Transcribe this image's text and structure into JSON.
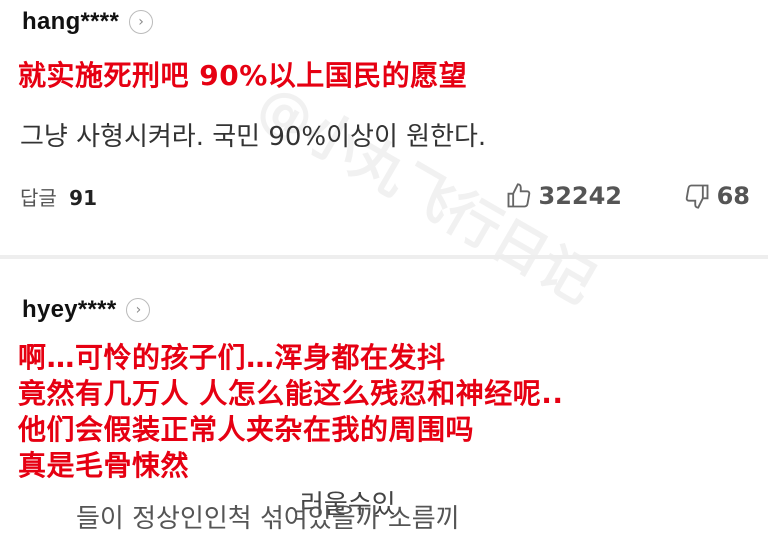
{
  "comments": [
    {
      "username": "hang****",
      "red_lines": [
        "就实施死刑吧 90%以上国民的愿望"
      ],
      "original_text": "그냥 사형시켜라. 국민 90%이상이 원한다.",
      "reply_label": "답글",
      "reply_count": "91",
      "likes": "32242",
      "dislikes": "68"
    },
    {
      "username": "hyey****",
      "red_lines": [
        "啊…可怜的孩子们…浑身都在发抖",
        "竟然有几万人 人怎么能这么残忍和神经呢..",
        "他们会假装正常人夹杂在我的周围吗",
        "真是毛骨悚然"
      ],
      "background_texts": [
        "러울수있",
        "들이 정상인인척 섞여있을까 소름끼"
      ]
    }
  ],
  "watermark": "@小丸飞行日记",
  "icons": [
    "chevron-right-icon",
    "thumb-up-icon",
    "thumb-down-icon"
  ],
  "colors": {
    "red_text": "#e60012",
    "divider": "#eeeeee"
  }
}
